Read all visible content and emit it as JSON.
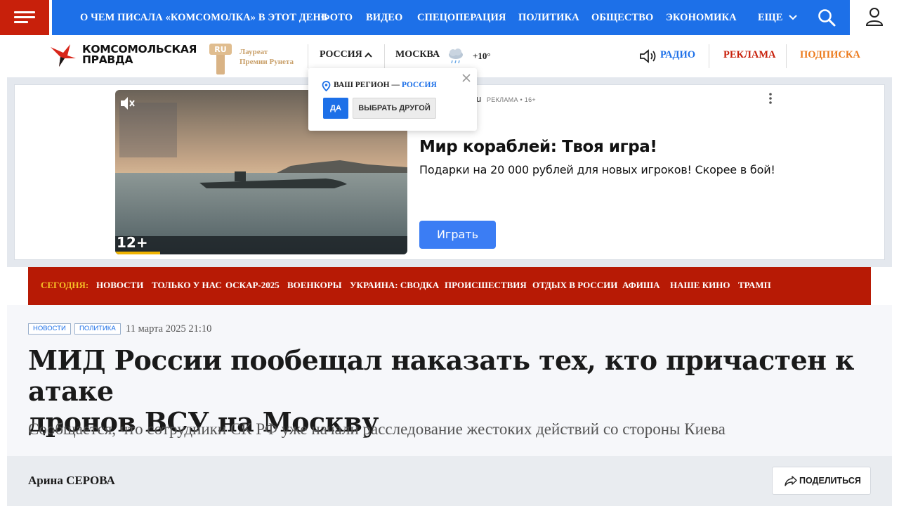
{
  "colors": {
    "brand_red": "#c8200b",
    "nav_blue": "#1d70e8",
    "today_bar": "#b71a05",
    "today_label": "#f6c026",
    "subscribe_orange": "#ec7a1c",
    "ad_cta": "#3b7df4"
  },
  "topnav": {
    "menu_icon": "hamburger-icon",
    "items": [
      "О ЧЕМ ПИСАЛА «КОМСОМОЛКА» В ЭТОТ ДЕНЬ",
      "ФОТО",
      "ВИДЕО",
      "СПЕЦОПЕРАЦИЯ",
      "ПОЛИТИКА",
      "ОБЩЕСТВО",
      "ЭКОНОМИКА",
      "ЕЩЕ"
    ],
    "search_icon": "search-icon",
    "user_icon": "user-icon"
  },
  "header": {
    "logo_line1": "КОМСОМОЛЬСКАЯ",
    "logo_line2": "ПРАВДА",
    "award_line1": "Лауреат",
    "award_line2": "Премии Рунета",
    "region": "РОССИЯ",
    "city": "МОСКВА",
    "weather_icon": "cloud-rain-icon",
    "temperature": "+10°",
    "radio": "РАДИО",
    "ads": "РЕКЛАМА",
    "subscribe": "ПОДПИСКА"
  },
  "region_popup": {
    "question": "ВАШ РЕГИОН — ",
    "region": "РОССИЯ",
    "yes": "ДА",
    "other": "ВЫБРАТЬ ДРУГОЙ"
  },
  "ad": {
    "source": "u",
    "meta": "РЕКЛАМА • 16+",
    "title": "Мир кораблей: Твоя игра!",
    "description": "Подарки на 20 000 рублей для новых игроков! Скорее в бой!",
    "cta": "Играть",
    "age_rating": "12+"
  },
  "today": {
    "label": "СЕГОДНЯ:",
    "items": [
      "НОВОСТИ",
      "ТОЛЬКО У НАС",
      "ОСКАР-2025",
      "ВОЕНКОРЫ",
      "УКРАИНА: СВОДКА",
      "ПРОИСШЕСТВИЯ",
      "ОТДЫХ В РОССИИ",
      "АФИША",
      "НАШЕ КИНО",
      "ТРАМП"
    ]
  },
  "article": {
    "tags": [
      "НОВОСТИ",
      "ПОЛИТИКА"
    ],
    "date": "11 марта 2025 21:10",
    "headline_line1": "МИД России пообещал наказать тех, кто причастен к атаке",
    "headline_line2": "дронов ВСУ на Москву",
    "subheadline": "Сообщается, что сотрудники СК РФ уже начали расследование жестоких действий со стороны Киева",
    "author": "Арина СЕРОВА",
    "share": "ПОДЕЛИТЬСЯ"
  }
}
